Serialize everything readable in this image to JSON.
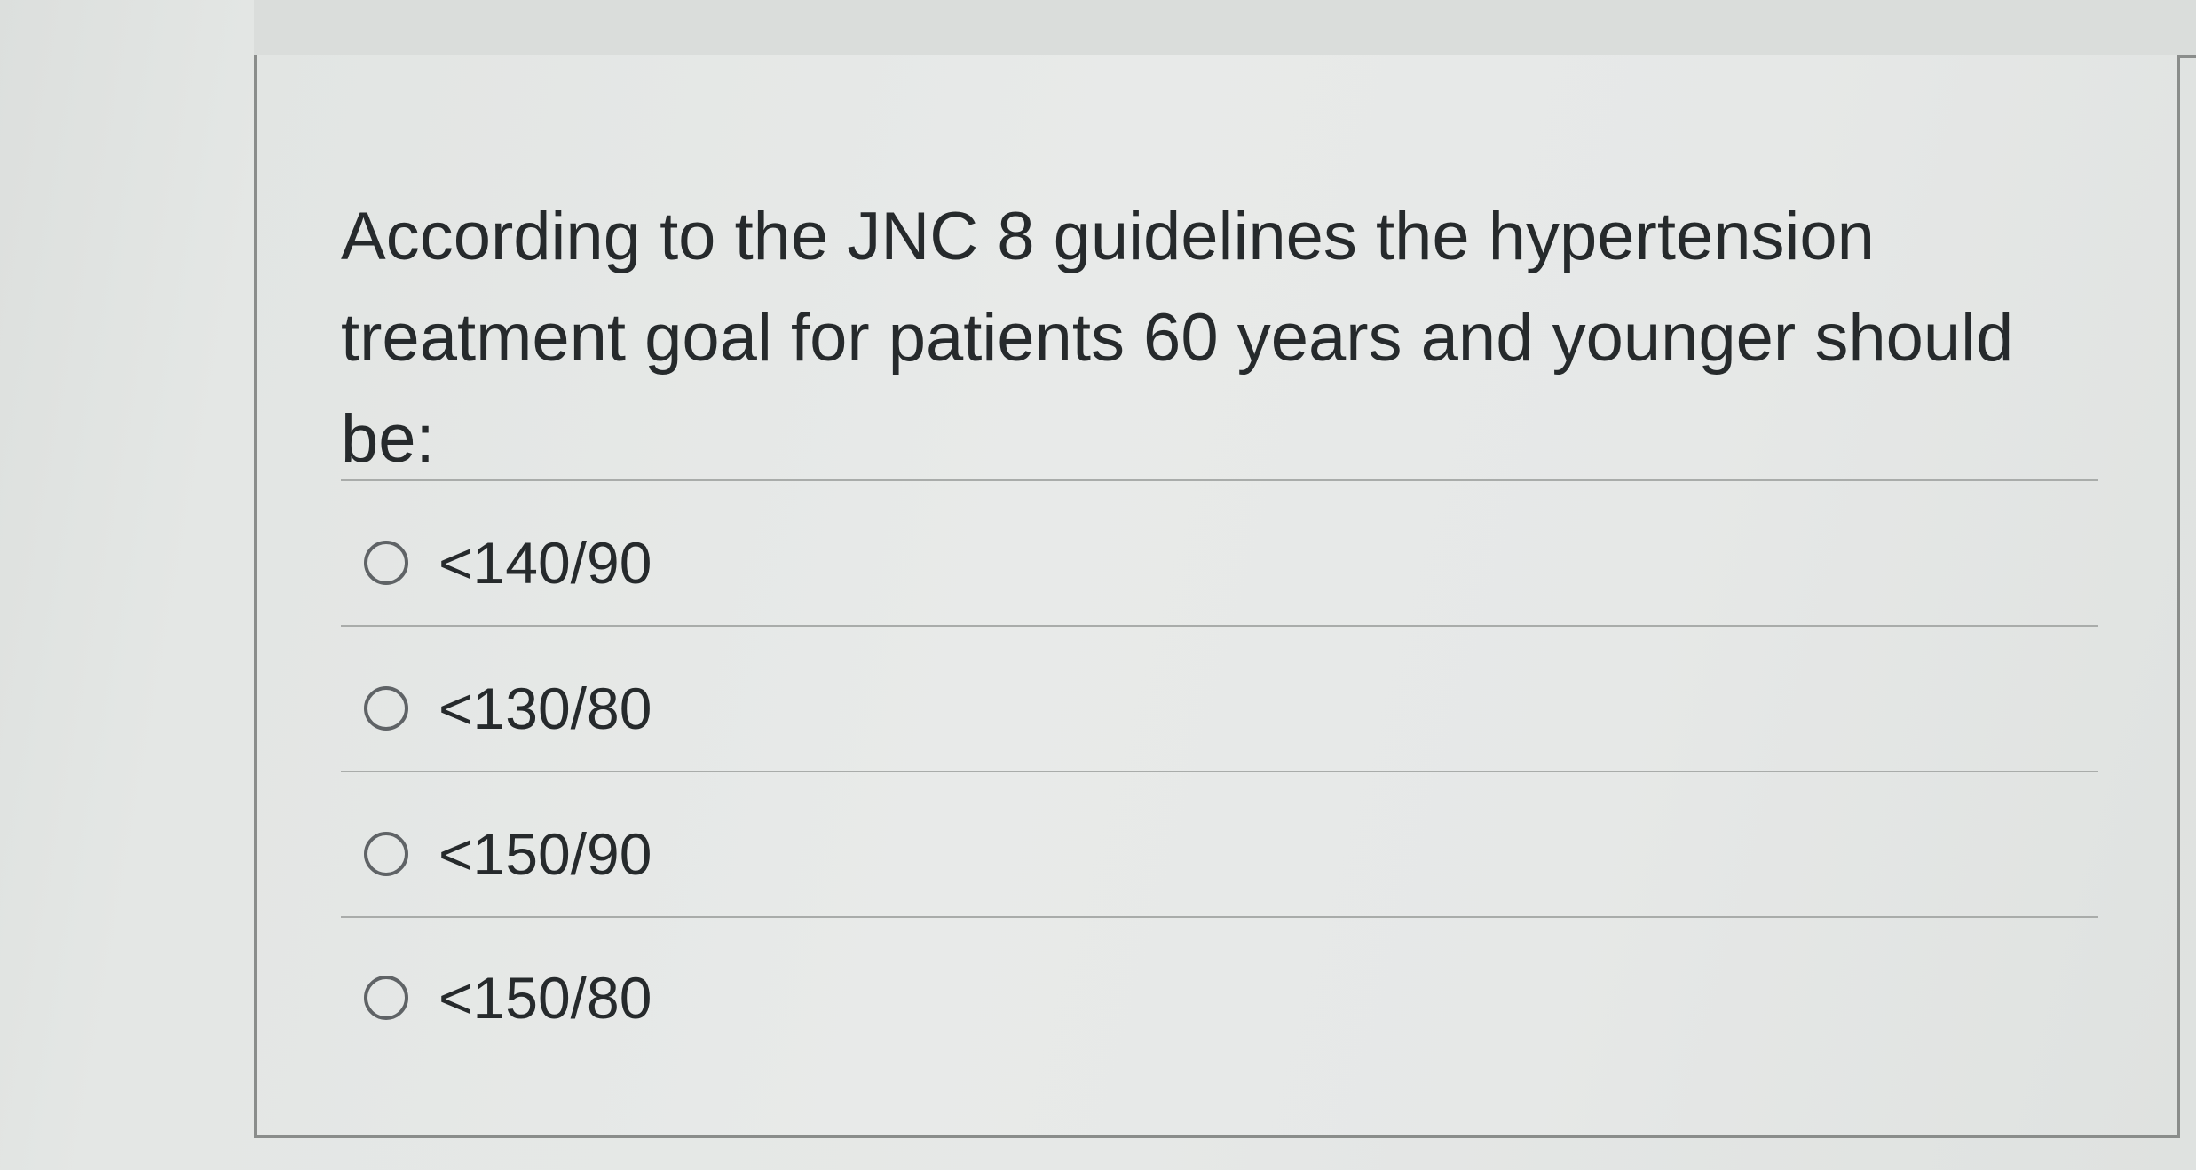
{
  "question": {
    "text": "According to the JNC 8 guidelines the hypertension treatment goal for patients 60 years and younger should be:"
  },
  "options": [
    {
      "label": "<140/90",
      "selected": false
    },
    {
      "label": "<130/80",
      "selected": false
    },
    {
      "label": "<150/90",
      "selected": false
    },
    {
      "label": "<150/80",
      "selected": false
    }
  ]
}
